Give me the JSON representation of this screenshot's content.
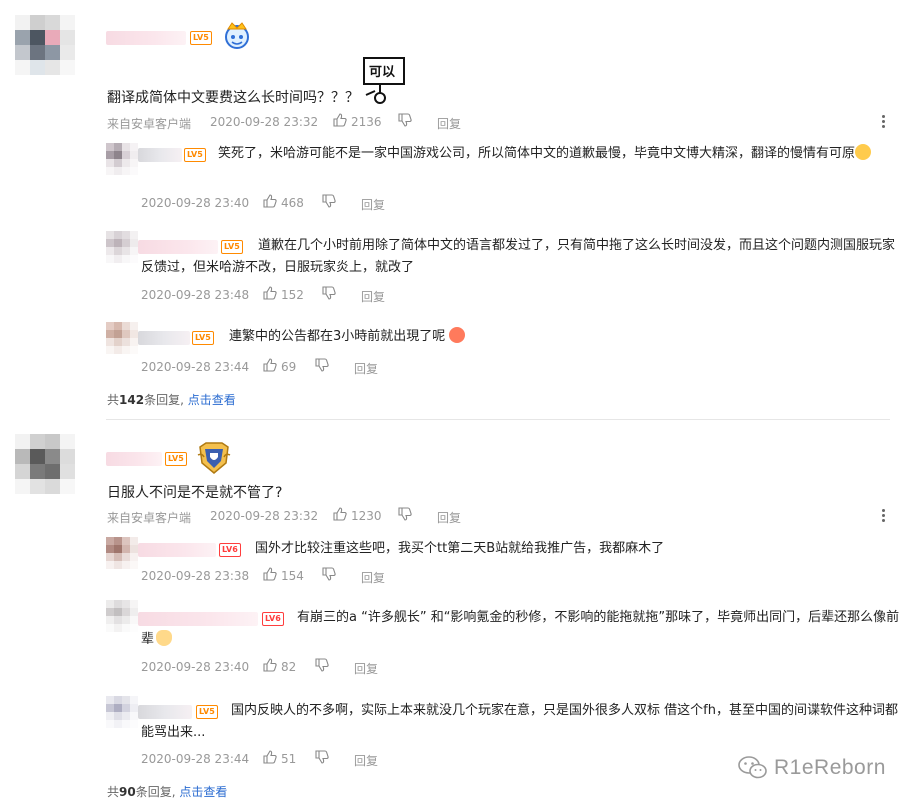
{
  "threads": [
    {
      "main_text": "翻译成简体中文要费这么长时间吗？？？",
      "sticker_text": "可以",
      "source": "来自安卓客户端",
      "time": "2020-09-28 23:32",
      "likes": "2136",
      "reply_label": "回复",
      "replies": [
        {
          "text": "笑死了，米哈游可能不是一家中国游戏公司，所以简体中文的道歉最慢，毕竟中文博大精深，翻译的慢情有可原",
          "time": "2020-09-28 23:40",
          "likes": "468",
          "reply_label": "回复"
        },
        {
          "text": "道歉在几个小时前用除了简体中文的语言都发过了，只有简中拖了这么长时间没发，而且这个问题内测国服玩家反馈过，但米哈游不改，日服玩家炎上，就改了",
          "time": "2020-09-28 23:48",
          "likes": "152",
          "reply_label": "回复"
        },
        {
          "text": "連繁中的公告都在3小時前就出現了呢",
          "time": "2020-09-28 23:44",
          "likes": "69",
          "reply_label": "回复"
        }
      ],
      "count_prefix": "共",
      "count": "142",
      "count_suffix": "条回复,",
      "view_link": "点击查看"
    },
    {
      "main_text": "日服人不问是不是就不管了?",
      "source": "来自安卓客户端",
      "time": "2020-09-28 23:32",
      "likes": "1230",
      "reply_label": "回复",
      "replies": [
        {
          "text": "国外才比较注重这些吧，我买个tt第二天B站就给我推广告，我都麻木了",
          "time": "2020-09-28 23:38",
          "likes": "154",
          "reply_label": "回复"
        },
        {
          "text": "有崩三的a “许多舰长” 和“影响氪金的秒修，不影响的能拖就拖”那味了，毕竟师出同门，后辈还那么像前辈",
          "time": "2020-09-28 23:40",
          "likes": "82",
          "reply_label": "回复"
        },
        {
          "text": "国内反映人的不多啊，实际上本来就没几个玩家在意，只是国外很多人双标 借这个fh，甚至中国的间谍软件这种词都能骂出来...",
          "time": "2020-09-28 23:44",
          "likes": "51",
          "reply_label": "回复"
        }
      ],
      "count_prefix": "共",
      "count": "90",
      "count_suffix": "条回复,",
      "view_link": "点击查看"
    }
  ],
  "level_badge": "LV5",
  "level_badge_alt": "LV6",
  "watermark": "R1eReborn",
  "colors": {
    "accent_link": "#2b6cd1",
    "badge_orange": "#ff8a00",
    "badge_red": "#ff3d3d",
    "meta_gray": "#999999"
  },
  "icons": [
    "thumb-up-icon",
    "thumb-down-icon",
    "more-vertical-icon",
    "wechat-icon",
    "crown-badge-icon",
    "shield-badge-icon"
  ]
}
